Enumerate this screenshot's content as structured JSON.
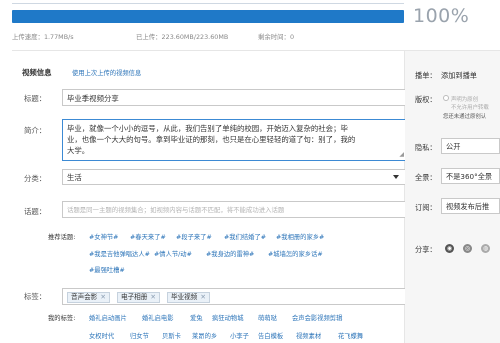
{
  "upload": {
    "percent_text": "100%",
    "progress": 1.0,
    "speed_label": "上传速度：1.77MB/s",
    "uploaded_label": "已上传：223.60MB/223.60MB",
    "remaining_label": "剩余时间：0"
  },
  "info": {
    "section_title": "视频信息",
    "reuse_link": "使用上次上传的视频信息",
    "title_label": "标题：",
    "title_value": "毕业季视频分享",
    "desc_label": "简介：",
    "desc_lines": [
      "毕业，就像一个小小的逗号，从此，我们告别了单纯的校园，开始迈入复杂的社会；毕",
      "业，也像一个大大的句号。拿到毕业证的那刻，也只是在心里轻轻的道了句：别了，我的",
      "大学。"
    ],
    "category_label": "分类：",
    "category_value": "生活",
    "topic_label": "话题：",
    "topic_placeholder": "话题是同一主题的视频集合；如视频内容与话题不匹配，将不能成功进入话题",
    "recommended_label": "推荐话题:",
    "recommended_topics": [
      "#女神节#",
      "#春天来了#",
      "#段子来了#",
      "#我们结婚了#",
      "#我相册的家乡#",
      "#我是吉他弹唱达人#",
      "#情人节/动#",
      "#我身边的雷神#",
      "#城墙怎的家乡话#",
      "#最强吐槽#"
    ],
    "tags_label": "标签：",
    "tags": [
      "音声会影",
      "电子相册",
      "毕业视频"
    ],
    "my_tags_label": "我的标签:",
    "my_tags": [
      "婚礼启动画片",
      "婚礼启电影",
      "爱兔",
      "疯狂动物城",
      "萌萌哒",
      "会声会影视频剪辑",
      "女权时代",
      "归女节",
      "贝斯卡",
      "莱昂的乡",
      "小李子",
      "告白模板",
      "视频素材",
      "花飞蝶舞"
    ]
  },
  "side": {
    "playlist_label": "播单：",
    "playlist_link": "添加到播单",
    "rights_label": "版权：",
    "rights_opt1": "声明为原创",
    "rights_opt2": "不允许用户转载",
    "rights_hint": "您还未通过原创认",
    "privacy_label": "隐私：",
    "privacy_value": "公开",
    "panorama_label": "全景：",
    "panorama_value": "不是360°全景",
    "subscribe_label": "订阅：",
    "subscribe_value": "视频发布后推",
    "share_label": "分享："
  },
  "colors": {
    "progress": "#1f79c8",
    "link": "#2a73b8",
    "focus": "#3c8ad4"
  }
}
